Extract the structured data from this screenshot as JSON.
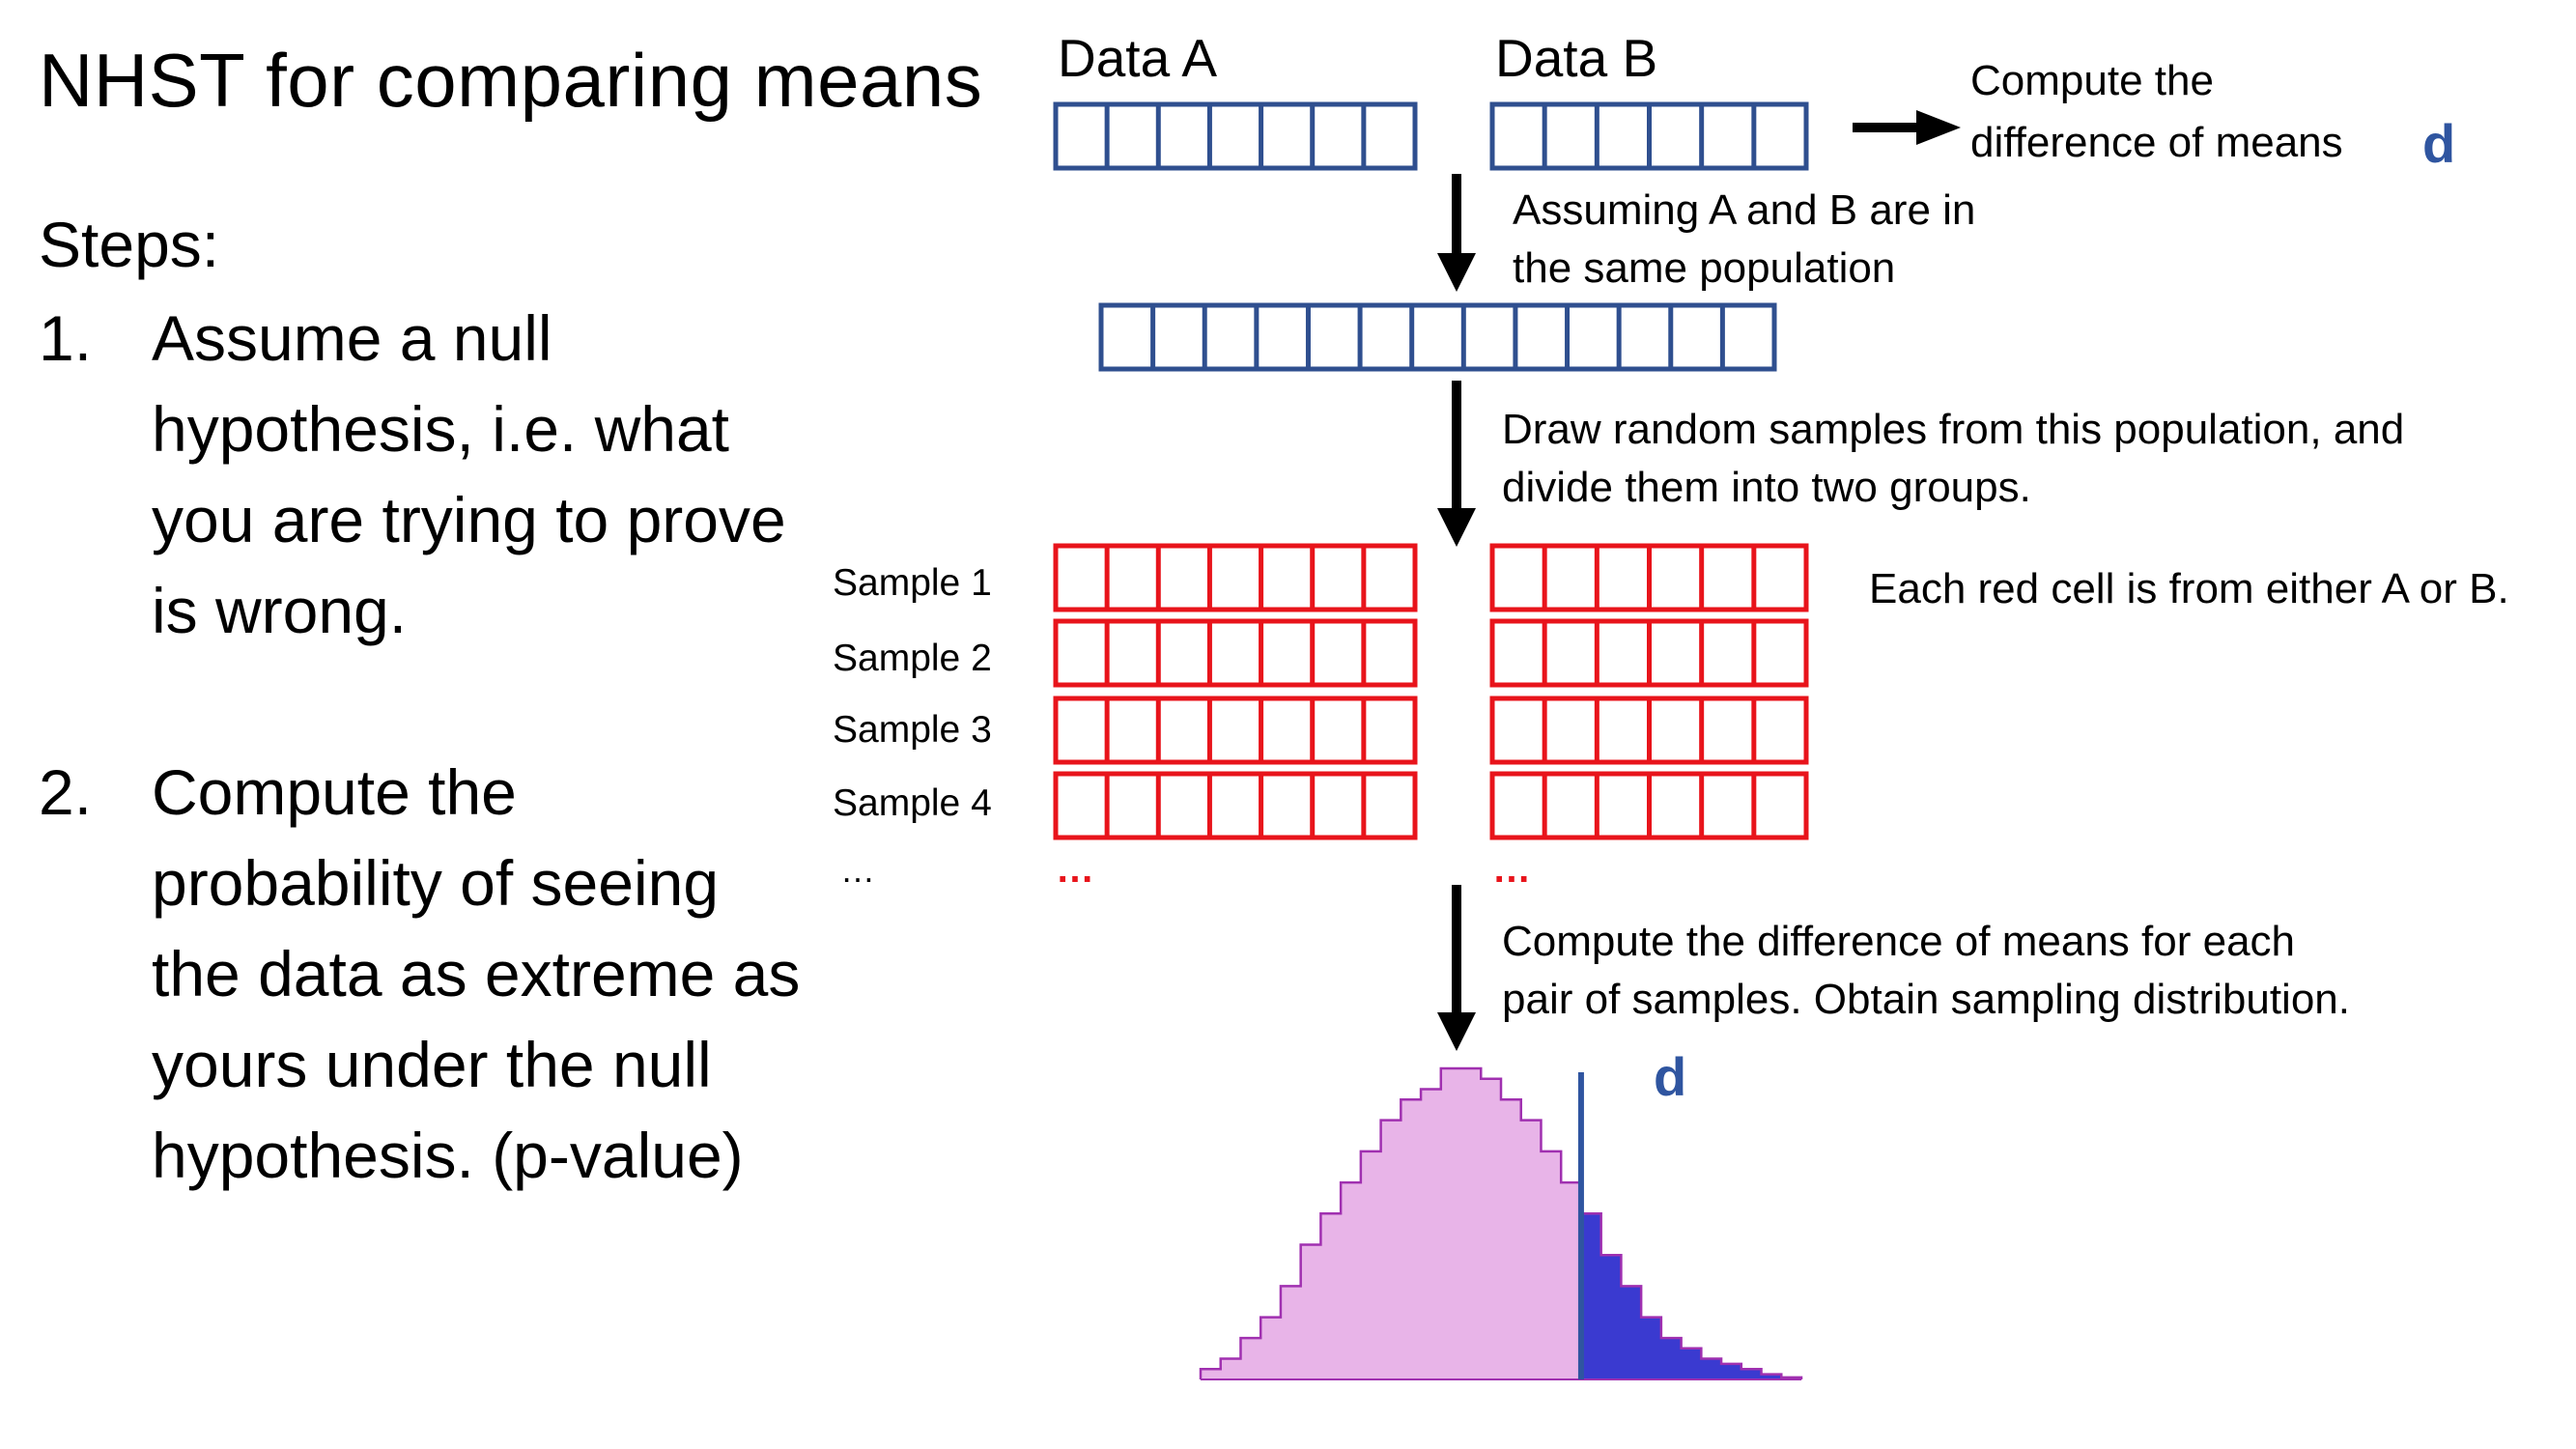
{
  "title": "NHST for comparing means",
  "steps": {
    "label": "Steps:",
    "items": [
      {
        "num": "1.",
        "lines": [
          "Assume a null",
          "hypothesis, i.e. what",
          "you are trying to prove",
          "is wrong."
        ]
      },
      {
        "num": "2.",
        "lines": [
          "Compute the",
          "probability of seeing",
          "the data as extreme as",
          "yours under the null",
          "hypothesis. (p-value)"
        ]
      }
    ]
  },
  "diagram": {
    "data_a_label": "Data A",
    "data_b_label": "Data B",
    "compute_diff": [
      "Compute the",
      "difference of means"
    ],
    "d_symbol": "d",
    "assume_same": [
      "Assuming A and B are in",
      "the same population"
    ],
    "draw_samples": [
      "Draw random samples from this population, and",
      "divide them into two groups."
    ],
    "red_cell_note": "Each red cell is from either A or B.",
    "sample_labels": [
      "Sample 1",
      "Sample 2",
      "Sample 3",
      "Sample 4"
    ],
    "sample_ellipsis": "…",
    "red_ellipsis": "…",
    "compute_pairs": [
      "Compute the difference of means for each",
      "pair of samples. Obtain sampling distribution."
    ],
    "colors": {
      "blue_box": "#2f4f8f",
      "red_box": "#e8141b",
      "hist_fill": "#e8b4e8",
      "hist_edge": "#a030b0",
      "tail_fill": "#3a3ad0",
      "d_line": "#2f55a0"
    },
    "histogram": {
      "bins": [
        1,
        2,
        4,
        6,
        9,
        13,
        16,
        19,
        22,
        25,
        27,
        28,
        30,
        30,
        29,
        27,
        25,
        22,
        19,
        16,
        12,
        9,
        6,
        4,
        3,
        2,
        1.5,
        1,
        0.5,
        0.2
      ],
      "d_bin_index": 19
    }
  }
}
